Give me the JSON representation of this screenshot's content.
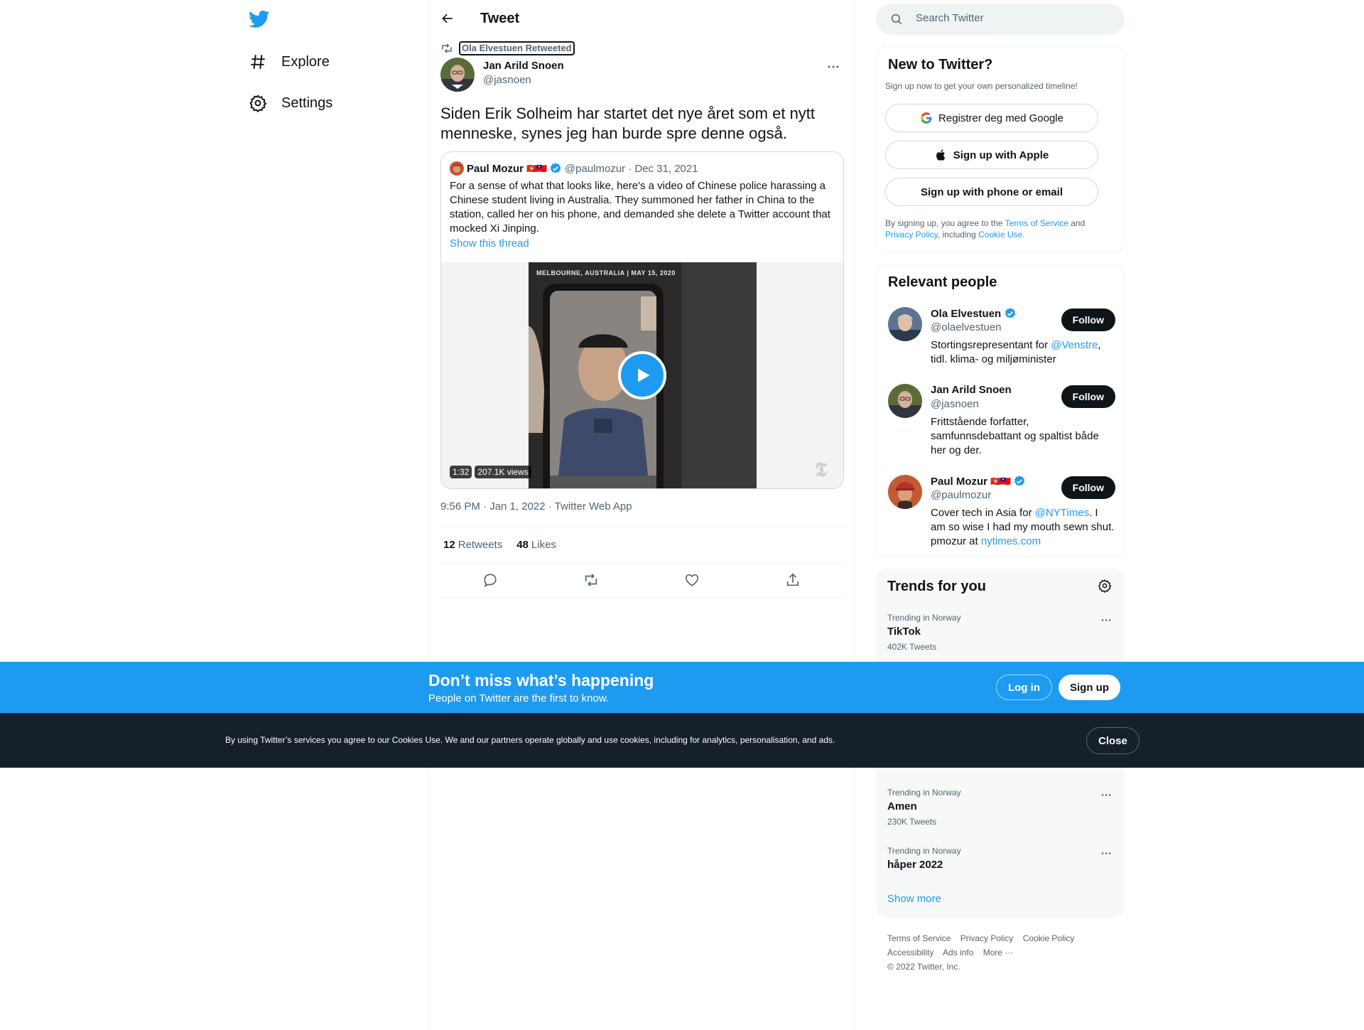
{
  "nav": {
    "explore_label": "Explore",
    "settings_label": "Settings"
  },
  "header": {
    "title": "Tweet"
  },
  "tweet": {
    "retweet_context": "Ola Elvestuen Retweeted",
    "author_name": "Jan Arild Snoen",
    "author_handle": "@jasnoen",
    "text": "Siden Erik Solheim har startet det nye året som et nytt menneske, synes jeg han burde spre denne også.",
    "timestamp": "9:56 PM · Jan 1, 2022 · Twitter Web App",
    "retweets_count": "12",
    "retweets_label": "Retweets",
    "likes_count": "48",
    "likes_label": "Likes"
  },
  "quote": {
    "name": "Paul Mozur",
    "flags": "🇭🇰🇹🇼",
    "handle": "@paulmozur",
    "date": "· Dec 31, 2021",
    "text": "For a sense of what that looks like, here's a video of Chinese police harassing a Chinese student living in Australia. They summoned her father in China to the station, called her on his phone, and demanded she delete a Twitter account that mocked Xi Jinping.",
    "show_thread": "Show this thread",
    "video_caption": "MELBOURNE, AUSTRALIA  |  MAY 15, 2020",
    "video_duration": "1:32",
    "video_views": "207.1K views"
  },
  "search": {
    "placeholder": "Search Twitter"
  },
  "new_to_twitter": {
    "title": "New to Twitter?",
    "subtitle": "Sign up now to get your own personalized timeline!",
    "google_label": "Registrer deg med Google",
    "apple_label": "Sign up with Apple",
    "phone_label": "Sign up with phone or email",
    "legal_prefix": "By signing up, you agree to the ",
    "terms": "Terms of Service",
    "and": " and ",
    "privacy": "Privacy Policy",
    "including": ", including ",
    "cookie": "Cookie Use."
  },
  "relevant_people": {
    "title": "Relevant people",
    "follow_label": "Follow",
    "people": [
      {
        "name": "Ola Elvestuen",
        "handle": "@olaelvestuen",
        "bio_pre": "Stortingsrepresentant for ",
        "bio_link": "@Venstre",
        "bio_post": ", tidl. klima- og miljøminister"
      },
      {
        "name": "Jan Arild Snoen",
        "handle": "@jasnoen",
        "bio": "Frittstående forfatter, samfunnsdebattant og spaltist både her og der."
      },
      {
        "name": "Paul Mozur",
        "flags": "🇭🇰🇹🇼",
        "handle": "@paulmozur",
        "bio_pre": "Cover tech in Asia for ",
        "bio_link": "@NYTimes",
        "bio_mid": ". I am so wise I had my mouth sewn shut. pmozur at ",
        "bio_link2": "nytimes.com"
      }
    ]
  },
  "trends": {
    "title": "Trends for you",
    "items": [
      {
        "context": "Trending in Norway",
        "name": "TikTok",
        "count": "402K Tweets"
      },
      {
        "context": "Trending in Norway",
        "name": "Amen",
        "count": "230K Tweets"
      },
      {
        "context": "Trending in Norway",
        "name": "håper 2022",
        "count": ""
      }
    ],
    "show_more": "Show more"
  },
  "footer": {
    "links": [
      "Terms of Service",
      "Privacy Policy",
      "Cookie Policy",
      "Accessibility",
      "Ads info",
      "More ···"
    ],
    "copyright": "© 2022 Twitter, Inc."
  },
  "signup_bar": {
    "headline": "Don’t miss what’s happening",
    "subline": "People on Twitter are the first to know.",
    "login_label": "Log in",
    "signup_label": "Sign up"
  },
  "cookie_bar": {
    "text": "By using Twitter’s services you agree to our Cookies Use. We and our partners operate globally and use cookies, including for analytics, personalisation, and ads.",
    "close_label": "Close"
  },
  "colors": {
    "accent": "#1d9bf0",
    "text": "#0f1419",
    "muted": "#536471",
    "cookie_bg": "#15202b"
  }
}
